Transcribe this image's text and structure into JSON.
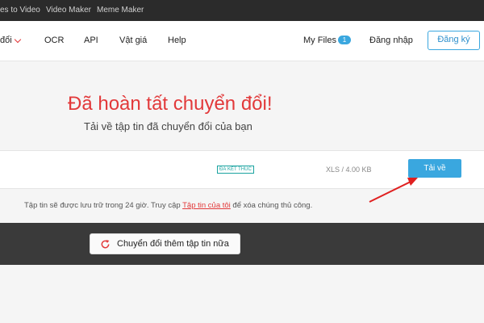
{
  "topbar": {
    "links": [
      "es to Video",
      "Video Maker",
      "Meme Maker"
    ]
  },
  "nav": {
    "convert_label": "đổi",
    "items": [
      "OCR",
      "API",
      "Vật giá",
      "Help"
    ],
    "my_files_label": "My Files",
    "my_files_count": "1",
    "login_label": "Đăng nhập",
    "signup_label": "Đăng ký"
  },
  "result": {
    "title": "Đã hoàn tất chuyển đổi!",
    "subtitle": "Tải về tập tin đã chuyển đổi của bạn"
  },
  "file": {
    "status": "ĐÃ KẾT THÚC",
    "size": "XLS / 4.00 KB",
    "download_label": "Tải về"
  },
  "note": {
    "before": "Tập tin sẽ được lưu trữ trong 24 giờ. Truy cập ",
    "link": "Tập tin của tôi",
    "after": " để xóa chúng thủ công."
  },
  "actions": {
    "convert_more_label": "Chuyển đổi thêm tập tin nữa"
  },
  "colors": {
    "accent_red": "#e2393a",
    "accent_blue": "#3aa7df",
    "status_teal": "#1aa3a0",
    "dark_band": "#3a3a3a"
  },
  "icons": {
    "convert_more": "refresh-icon",
    "nav_dropdown": "chevron-down-icon",
    "annotation": "red-arrow"
  }
}
